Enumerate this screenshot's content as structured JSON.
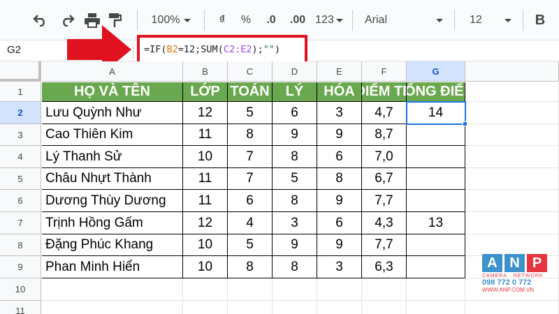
{
  "toolbar": {
    "zoom": "100%",
    "currency": "₫",
    "percent": "%",
    "dec_decrease": ".0",
    "dec_increase": ".00",
    "more_formats": "123",
    "font": "Arial",
    "font_size": "12",
    "bold": "B"
  },
  "formula_bar": {
    "name_box": "G2",
    "formula_parts": {
      "p1": "=IF(",
      "b2": "B2",
      "p2": "=12;SUM(",
      "range": "C2:E2",
      "p3": ");",
      "str": "\"\"",
      "p4": ")"
    }
  },
  "sheet": {
    "columns": [
      "A",
      "B",
      "C",
      "D",
      "E",
      "F",
      "G"
    ],
    "rows": [
      "1",
      "2",
      "3",
      "4",
      "5",
      "6",
      "7",
      "8",
      "9",
      "10",
      "11"
    ],
    "headers": [
      "HỌ VÀ TÊN",
      "LỚP",
      "TOÁN",
      "LÝ",
      "HÓA",
      "ĐIỂM TB",
      "TỔNG ĐIỂM"
    ],
    "data": [
      [
        "Lưu Quỳnh Như",
        "12",
        "5",
        "6",
        "3",
        "4,7",
        "14"
      ],
      [
        "Cao Thiên Kim",
        "11",
        "8",
        "9",
        "9",
        "8,7",
        ""
      ],
      [
        "Lý Thanh Sử",
        "10",
        "7",
        "8",
        "6",
        "7,0",
        ""
      ],
      [
        "Châu Nhựt Thành",
        "11",
        "7",
        "5",
        "8",
        "6,7",
        ""
      ],
      [
        "Dương Thùy Dương",
        "11",
        "6",
        "8",
        "9",
        "7,7",
        ""
      ],
      [
        "Trịnh Hồng Gấm",
        "12",
        "4",
        "3",
        "6",
        "4,3",
        "13"
      ],
      [
        "Đặng Phúc Khang",
        "10",
        "5",
        "9",
        "9",
        "7,7",
        ""
      ],
      [
        "Phan Minh Hiển",
        "10",
        "8",
        "8",
        "3",
        "6,3",
        ""
      ]
    ],
    "selected_cell": "G2",
    "header_color": "#6aa84f"
  },
  "watermark": {
    "letters": [
      "A",
      "N",
      "P"
    ],
    "tagline": "CAMERA · NETWORK",
    "phone": "098 772 0 772",
    "url": "WWW.ANP.COM.VN"
  },
  "colors": {
    "highlight_box": "#e1121f",
    "arrow": "#e1121f",
    "selection": "#1a73e8"
  }
}
